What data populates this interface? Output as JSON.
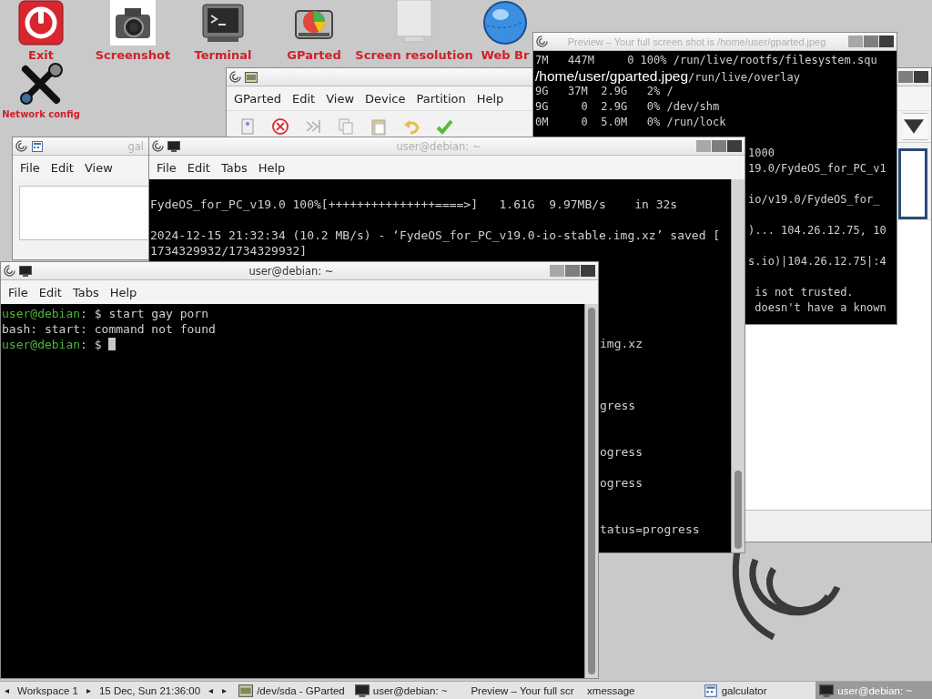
{
  "desktop_icons": [
    {
      "kind": "exit",
      "label": "Exit"
    },
    {
      "kind": "camera",
      "label": "Screenshot"
    },
    {
      "kind": "terminal",
      "label": "Terminal"
    },
    {
      "kind": "disk",
      "label": "GParted"
    },
    {
      "kind": "monitor",
      "label": "Screen resolution"
    },
    {
      "kind": "globe",
      "label": "Web Br"
    },
    {
      "kind": "tools",
      "label": "Network config"
    }
  ],
  "windows": [
    {
      "kind": "gparted",
      "menu": [
        "GParted",
        "Edit",
        "View",
        "Device",
        "Partition",
        "Help"
      ]
    },
    {
      "kind": "preview",
      "active": false,
      "title": "Preview – Your full screen shot is /home/user/gparted.jpeg",
      "lines": [
        {
          "text": "7M   447M     0 100% /run/live/rootfs/filesystem.squ"
        },
        {
          "caption": "/home/user/gparted.jpeg",
          "text": "/run/live/overlay"
        },
        {
          "text": "9G   37M  2.9G   2% /"
        },
        {
          "text": "9G     0  2.9G   0% /dev/shm"
        },
        {
          "text": "0M     0  5.0M   0% /run/lock"
        }
      ],
      "side_lines": [
        "1000",
        "19.0/FydeOS_for_PC_v1",
        "io/v19.0/FydeOS_for_",
        ")... 104.26.12.75, 10",
        "s.io)|104.26.12.75|:4",
        " is not trusted.",
        " doesn't have a known"
      ]
    },
    {
      "kind": "galculator",
      "active": false,
      "title": "gal",
      "menu": [
        "File",
        "Edit",
        "View"
      ]
    },
    {
      "kind": "terminal",
      "active": false,
      "title": "user@debian: ~",
      "menu": [
        "File",
        "Edit",
        "Tabs",
        "Help"
      ],
      "lines": [
        {
          "text": "FydeOS_for_PC_v19.0 100%[+++++++++++++++====>]   1.61G  9.97MB/s    in 32s"
        },
        {
          "text": "2024-12-15 21:32:34 (10.2 MB/s) - ‘FydeOS_for_PC_v19.0-io-stable.img.xz’ saved ["
        },
        {
          "text": "1734329932/1734329932]"
        }
      ],
      "side_lines": [
        "img.xz",
        "gress",
        "ogress",
        "ogress",
        "tatus=progress"
      ]
    },
    {
      "kind": "terminal",
      "active": true,
      "title": "user@debian: ~",
      "menu": [
        "File",
        "Edit",
        "Tabs",
        "Help"
      ],
      "lines": [
        {
          "prompt": "user@debian",
          "text": ": $ start gay porn",
          "cursor": false
        },
        {
          "text": "bash: start: command not found"
        },
        {
          "prompt": "user@debian",
          "text": ": $ ",
          "cursor": true
        }
      ]
    }
  ],
  "taskbar": {
    "workspace_prev": "◂",
    "workspace": "Workspace 1",
    "workspace_next": "▸",
    "clock": "15 Dec, Sun 21:36:00",
    "tasks_prev": "◂",
    "tasks_next": "▸",
    "tasks": [
      {
        "kind": "gparted",
        "label": "/dev/sda - GParted",
        "selected": false
      },
      {
        "kind": "terminal",
        "label": "user@debian: ~",
        "selected": false
      },
      {
        "kind": "plain",
        "label": "Preview – Your full scr",
        "selected": false
      },
      {
        "kind": "plain",
        "label": "xmessage",
        "selected": false
      },
      {
        "kind": "calculator",
        "label": "galculator",
        "selected": false
      },
      {
        "kind": "terminal",
        "label": "user@debian: ~",
        "selected": true
      }
    ]
  }
}
